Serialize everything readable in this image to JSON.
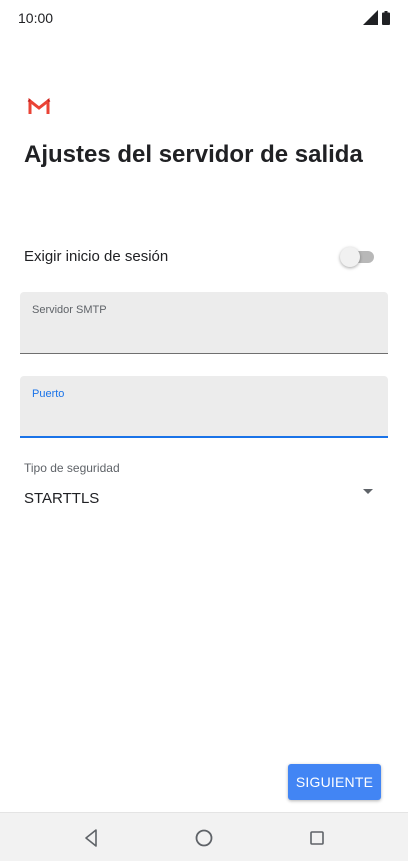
{
  "status_bar": {
    "time": "10:00",
    "icons": [
      "signal-icon",
      "battery-icon"
    ]
  },
  "header": {
    "logo": "gmail-logo",
    "title": "Ajustes del servidor de salida"
  },
  "signin_required": {
    "label": "Exigir inicio de sesión",
    "enabled": false
  },
  "fields": {
    "smtp_server": {
      "label": "Servidor SMTP",
      "value": ""
    },
    "port": {
      "label": "Puerto",
      "value": "",
      "focused": true
    }
  },
  "security": {
    "label": "Tipo de seguridad",
    "selected": "STARTTLS"
  },
  "actions": {
    "next_label": "SIGUIENTE"
  },
  "navigation": {
    "buttons": [
      "back-icon",
      "home-icon",
      "recents-icon"
    ]
  },
  "colors": {
    "accent": "#1a73e8",
    "button": "#4285f4",
    "field_background": "#ececec",
    "gmail_red": "#ea4335"
  }
}
